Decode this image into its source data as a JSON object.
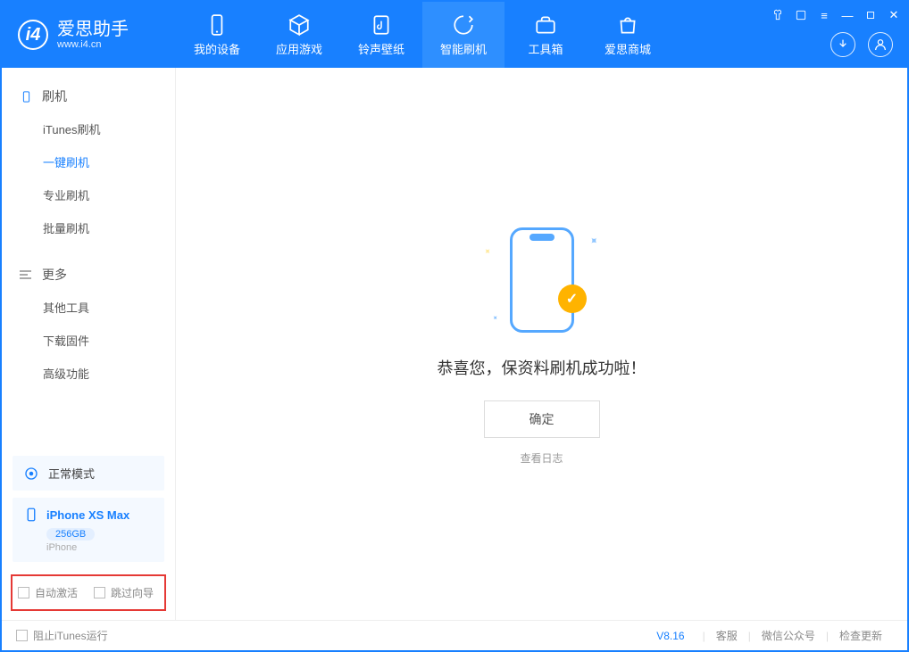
{
  "logo": {
    "cn": "爱思助手",
    "en": "www.i4.cn"
  },
  "tabs": [
    {
      "label": "我的设备"
    },
    {
      "label": "应用游戏"
    },
    {
      "label": "铃声壁纸"
    },
    {
      "label": "智能刷机"
    },
    {
      "label": "工具箱"
    },
    {
      "label": "爱思商城"
    }
  ],
  "sidebar": {
    "group1_title": "刷机",
    "items1": [
      {
        "label": "iTunes刷机"
      },
      {
        "label": "一键刷机"
      },
      {
        "label": "专业刷机"
      },
      {
        "label": "批量刷机"
      }
    ],
    "group2_title": "更多",
    "items2": [
      {
        "label": "其他工具"
      },
      {
        "label": "下载固件"
      },
      {
        "label": "高级功能"
      }
    ],
    "mode_card": "正常模式",
    "device": {
      "name": "iPhone XS Max",
      "storage": "256GB",
      "type": "iPhone"
    },
    "opt1": "自动激活",
    "opt2": "跳过向导"
  },
  "main": {
    "message": "恭喜您，保资料刷机成功啦！",
    "ok": "确定",
    "log": "查看日志"
  },
  "footer": {
    "stop_itunes": "阻止iTunes运行",
    "version": "V8.16",
    "link1": "客服",
    "link2": "微信公众号",
    "link3": "检查更新"
  }
}
